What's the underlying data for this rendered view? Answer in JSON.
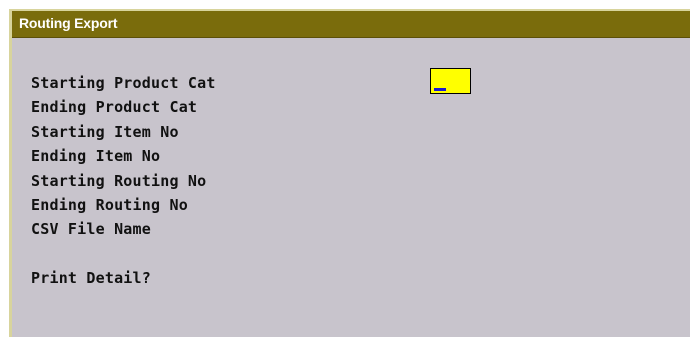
{
  "window": {
    "title": "Routing Export"
  },
  "form": {
    "fields": [
      {
        "label": "Starting Product Cat"
      },
      {
        "label": "Ending Product Cat"
      },
      {
        "label": "Starting Item No"
      },
      {
        "label": "Ending Item No"
      },
      {
        "label": "Starting Routing No"
      },
      {
        "label": "Ending Routing No"
      },
      {
        "label": "CSV File Name"
      }
    ],
    "print_detail_label": "Print Detail?",
    "active_input": {
      "value": "",
      "background_color": "#ffff00",
      "caret_color": "#1a1ad0"
    }
  },
  "colors": {
    "titlebar": "#7a6c0c",
    "panel": "#c8c4cc",
    "frame": "#d8d49c"
  }
}
